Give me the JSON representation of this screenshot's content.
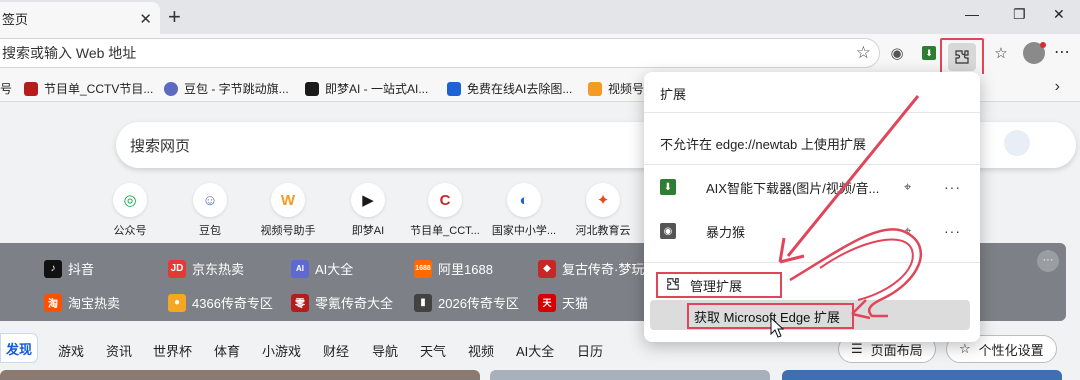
{
  "tab": {
    "title": "签页",
    "close": "✕"
  },
  "window": {
    "newtab": "+",
    "minimize": "—",
    "restore": "❐",
    "close": "✕"
  },
  "address": {
    "text": "搜索或输入 Web 地址"
  },
  "favorites": [
    {
      "label": "号",
      "color": "#f0f0f0"
    },
    {
      "label": "节目单_CCTV节目...",
      "color": "#b71c1c"
    },
    {
      "label": "豆包 - 字节跳动旗...",
      "color": "#5c6bc0"
    },
    {
      "label": "即梦AI - 一站式AI...",
      "color": "#1a1a1a"
    },
    {
      "label": "免费在线AI去除图...",
      "color": "#1e63d6"
    },
    {
      "label": "视频号助",
      "color": "#f59a23"
    }
  ],
  "search": {
    "placeholder": "搜索网页"
  },
  "tiles": [
    {
      "label": "公众号",
      "glyph": "◎",
      "color": "#17a34a"
    },
    {
      "label": "豆包",
      "glyph": "☺",
      "color": "#5c6bc0"
    },
    {
      "label": "视频号助手",
      "glyph": "W",
      "color": "#f59a23"
    },
    {
      "label": "即梦AI",
      "glyph": "▶",
      "color": "#1a1a1a"
    },
    {
      "label": "节目单_CCT...",
      "glyph": "C",
      "color": "#c62828"
    },
    {
      "label": "国家中小学...",
      "glyph": "◐",
      "color": "#1e63d6"
    },
    {
      "label": "河北教育云",
      "glyph": "✦",
      "color": "#e64a19"
    }
  ],
  "hot_row1": [
    {
      "label": "抖音",
      "icon": "♪",
      "color": "#111111"
    },
    {
      "label": "京东热卖",
      "icon": "JD",
      "color": "#e53935"
    },
    {
      "label": "AI大全",
      "icon": "AI",
      "color": "#5e6ad2"
    },
    {
      "label": "阿里1688",
      "icon": "1688",
      "color": "#ff6a00"
    },
    {
      "label": "复古传奇·梦玩",
      "icon": "◆",
      "color": "#c62828"
    }
  ],
  "hot_row2": [
    {
      "label": "淘宝热卖",
      "icon": "淘",
      "color": "#ff5000"
    },
    {
      "label": "4366传奇专区",
      "icon": "●",
      "color": "#f5a623"
    },
    {
      "label": "零氪传奇大全",
      "icon": "零",
      "color": "#b71c1c"
    },
    {
      "label": "2026传奇专区",
      "icon": "▮",
      "color": "#424242"
    },
    {
      "label": "天猫",
      "icon": "天",
      "color": "#d50000"
    }
  ],
  "hot_more": "···",
  "nav": {
    "active": "发现",
    "items": [
      "游戏",
      "资讯",
      "世界杯",
      "体育",
      "小游戏",
      "财经",
      "导航",
      "天气",
      "视频",
      "AI大全",
      "日历"
    ],
    "layout_btn": "页面布局",
    "personalize_btn": "个性化设置"
  },
  "extensions_popup": {
    "title": "扩展",
    "notice": "不允许在 edge://newtab 上使用扩展",
    "items": [
      {
        "name": "AIX智能下载器(图片/视频/音...",
        "icon": "⬇",
        "color": "#2e7d32"
      },
      {
        "name": "暴力猴",
        "icon": "◉",
        "color": "#555555"
      }
    ],
    "more": "···",
    "manage": "管理扩展",
    "get": "获取 Microsoft Edge 扩展"
  },
  "colors": {
    "accent": "#0f5bd6",
    "annotation": "#e0455a"
  }
}
